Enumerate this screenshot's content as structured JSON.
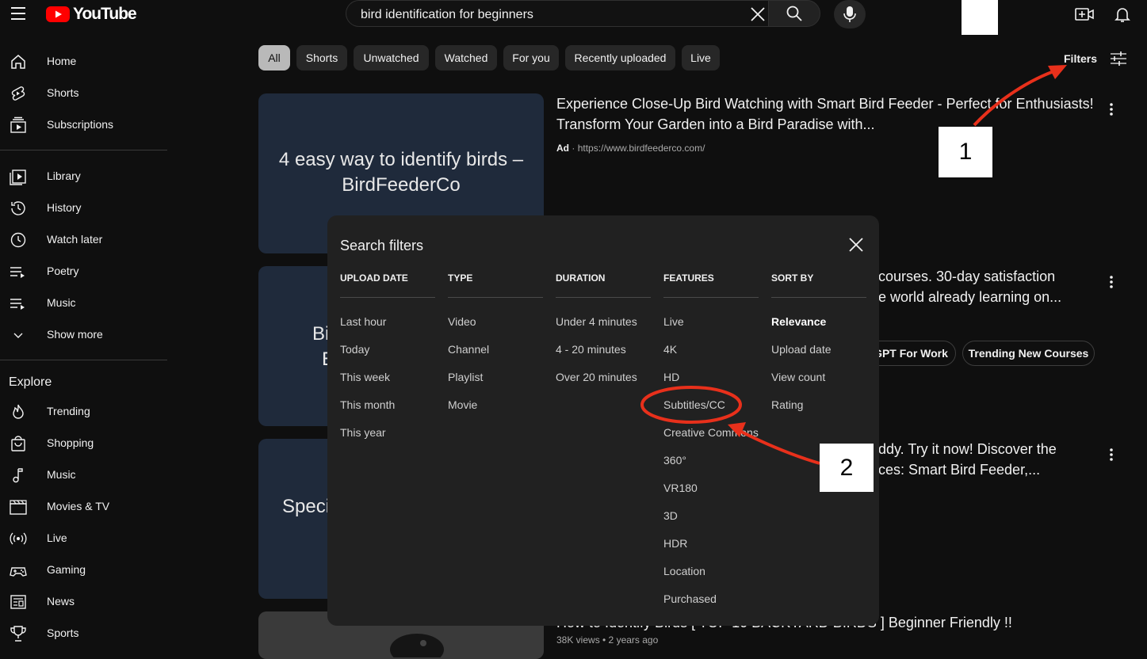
{
  "topbar": {
    "logo_text": "YouTube",
    "search_value": "bird identification for beginners",
    "icons": [
      "menu-icon",
      "youtube-logo-icon",
      "clear-icon",
      "search-icon",
      "mic-icon",
      "create-icon",
      "bell-icon"
    ]
  },
  "sidebar": {
    "main": [
      {
        "label": "Home",
        "icon": "home-icon"
      },
      {
        "label": "Shorts",
        "icon": "shorts-icon"
      },
      {
        "label": "Subscriptions",
        "icon": "subscriptions-icon"
      }
    ],
    "library": [
      {
        "label": "Library",
        "icon": "library-icon"
      },
      {
        "label": "History",
        "icon": "history-icon"
      },
      {
        "label": "Watch later",
        "icon": "clock-icon"
      },
      {
        "label": "Poetry",
        "icon": "playlist-icon"
      },
      {
        "label": "Music",
        "icon": "playlist-icon"
      },
      {
        "label": "Show more",
        "icon": "chevron-down-icon"
      }
    ],
    "explore_title": "Explore",
    "explore": [
      {
        "label": "Trending",
        "icon": "trending-icon"
      },
      {
        "label": "Shopping",
        "icon": "shopping-bag-icon"
      },
      {
        "label": "Music",
        "icon": "music-note-icon"
      },
      {
        "label": "Movies & TV",
        "icon": "clapperboard-icon"
      },
      {
        "label": "Live",
        "icon": "live-icon"
      },
      {
        "label": "Gaming",
        "icon": "gamepad-icon"
      },
      {
        "label": "News",
        "icon": "news-icon"
      },
      {
        "label": "Sports",
        "icon": "trophy-icon"
      }
    ]
  },
  "chips": [
    "All",
    "Shorts",
    "Unwatched",
    "Watched",
    "For you",
    "Recently uploaded",
    "Live"
  ],
  "filters_label": "Filters",
  "results": [
    {
      "thumb_text_1": "4 easy way to identify birds –",
      "thumb_text_2": "BirdFeederCo",
      "title_1": "Experience Close-Up Bird Watching with Smart Bird Feeder - Perfect for Enthusiasts!",
      "title_2": "Transform Your Garden into a Bird Paradise with...",
      "ad_badge": "Ad",
      "url": "https://www.birdfeederco.com/"
    },
    {
      "thumb_text_1": "Bi",
      "thumb_text_2": "E",
      "title_1": "courses. 30-day satisfaction",
      "title_2": "e world already learning on...",
      "chip_1": "GPT For Work",
      "chip_2": "Trending New Courses"
    },
    {
      "thumb_text_1": "Speci",
      "title_1": "ddy. Try it now! Discover the",
      "title_2": "ces: Smart Bird Feeder,..."
    },
    {
      "title_1": "How to Identify Birds [ TOP 10 BACKYARD BIRDS ] Beginner Friendly !!",
      "meta": "38K views • 2 years ago"
    }
  ],
  "modal": {
    "title": "Search filters",
    "columns": [
      {
        "heading": "UPLOAD DATE",
        "options": [
          "Last hour",
          "Today",
          "This week",
          "This month",
          "This year"
        ]
      },
      {
        "heading": "TYPE",
        "options": [
          "Video",
          "Channel",
          "Playlist",
          "Movie"
        ]
      },
      {
        "heading": "DURATION",
        "options": [
          "Under 4 minutes",
          "4 - 20 minutes",
          "Over 20 minutes"
        ]
      },
      {
        "heading": "FEATURES",
        "options": [
          "Live",
          "4K",
          "HD",
          "Subtitles/CC",
          "Creative Commons",
          "360°",
          "VR180",
          "3D",
          "HDR",
          "Location",
          "Purchased"
        ]
      },
      {
        "heading": "SORT BY",
        "options": [
          "Relevance",
          "Upload date",
          "View count",
          "Rating"
        ],
        "selected": "Relevance"
      }
    ]
  },
  "annotations": {
    "step_1": "1",
    "step_2": "2",
    "arrow_color": "#e8301b"
  },
  "colors": {
    "background": "#0f0f0f",
    "brand_red": "#ff0000",
    "modal_bg": "#212121",
    "thumb_bg": "#1f2a3b"
  }
}
